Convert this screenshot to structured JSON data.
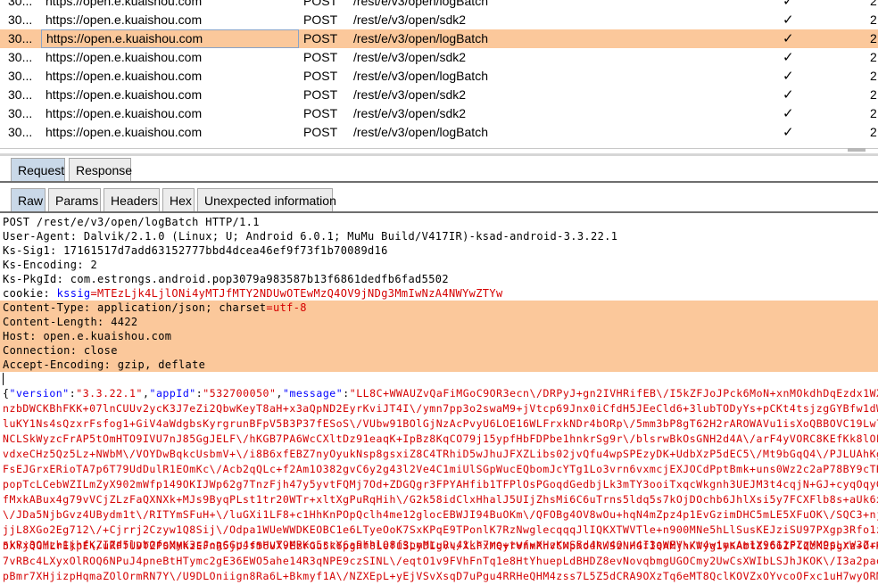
{
  "history": {
    "rows": [
      {
        "num": "30...",
        "host": "https://open.e.kuaishou.com",
        "method": "POST",
        "url": "/rest/e/v3/open/logBatch",
        "check": "✓",
        "last": "2",
        "selected": false
      },
      {
        "num": "30...",
        "host": "https://open.e.kuaishou.com",
        "method": "POST",
        "url": "/rest/e/v3/open/sdk2",
        "check": "✓",
        "last": "2",
        "selected": false
      },
      {
        "num": "30...",
        "host": "https://open.e.kuaishou.com",
        "method": "POST",
        "url": "/rest/e/v3/open/logBatch",
        "check": "✓",
        "last": "2",
        "selected": true
      },
      {
        "num": "30...",
        "host": "https://open.e.kuaishou.com",
        "method": "POST",
        "url": "/rest/e/v3/open/sdk2",
        "check": "✓",
        "last": "2",
        "selected": false
      },
      {
        "num": "30...",
        "host": "https://open.e.kuaishou.com",
        "method": "POST",
        "url": "/rest/e/v3/open/logBatch",
        "check": "✓",
        "last": "2",
        "selected": false
      },
      {
        "num": "30...",
        "host": "https://open.e.kuaishou.com",
        "method": "POST",
        "url": "/rest/e/v3/open/sdk2",
        "check": "✓",
        "last": "2",
        "selected": false
      },
      {
        "num": "30...",
        "host": "https://open.e.kuaishou.com",
        "method": "POST",
        "url": "/rest/e/v3/open/sdk2",
        "check": "✓",
        "last": "2",
        "selected": false
      },
      {
        "num": "30...",
        "host": "https://open.e.kuaishou.com",
        "method": "POST",
        "url": "/rest/e/v3/open/logBatch",
        "check": "✓",
        "last": "2",
        "selected": false
      }
    ]
  },
  "main_tabs": {
    "request": "Request",
    "response": "Response"
  },
  "sub_tabs": {
    "raw": "Raw",
    "params": "Params",
    "headers": "Headers",
    "hex": "Hex",
    "unexpected": "Unexpected information"
  },
  "request": {
    "line1": "POST /rest/e/v3/open/logBatch HTTP/1.1",
    "line2": "User-Agent: Dalvik/2.1.0 (Linux; U; Android 6.0.1; MuMu Build/V417IR)-ksad-android-3.3.22.1",
    "line3": "Ks-Sig1: 17161517d7add63152777bbd4dcea46ef9f73f1b70089d16",
    "line4": "Ks-Encoding: 2",
    "line5": "Ks-PkgId: com.estrongs.android.pop3079a983587b13f6861dedfb6fad5502",
    "cookie_name": "cookie: ",
    "cookie_key": "kssig",
    "cookie_value": "=MTEzLjk4LjlONi4yMTJfMTY2NDUwOTEwMzQ4OV9jNDg3MmIwNzA4NWYwZTYw",
    "content_type_a": "Content-Type: application/json; charset",
    "content_type_b": "=utf-8",
    "line8": "Content-Length: 4422",
    "line9": "Host: open.e.kuaishou.com",
    "line10": "Connection: close",
    "line11": "Accept-Encoding: gzip, deflate"
  },
  "body": {
    "k_version": "\"version\"",
    "v_version": "\"3.3.22.1\"",
    "k_appid": "\"appId\"",
    "v_appid": "\"532700050\"",
    "k_message": "\"message\"",
    "v_message_start": "\"LL8C+WWAUZvQaFiMGoC9OR3ecn\\/DRPyJ+gn2IVHRifEB\\/I5kZFJoJPck6MoN+xnMOkdhDqEzdx1WXyJD8L6dY",
    "lines": [
      "nzbDWCKBhFKK+07lnCUUv2ycK3J7eZi2QbwKeyT8aH+x3aQpND2EyrKviJT4I\\/ymn7pp3o2swaM9+jVtcp69Jnx0iCfdH5JEeCld6+3lubTODyYs+pCKt4tsjzgGYBfw1dWdKko1NxB",
      "luKY1Ns4sQzxrFsfog1+GiV4aWdgbsKyrgrunBFpV5B3P37fESoS\\/VUbw91BOlGjNzAcPvyU6LOE16WLFrxkNDr4bORp\\/5mm3bP8gT62H2rAROWAVu1isXoQBBOVC19Lw72Lc\\/+3YK",
      "NCLSkWyzcFrAP5tOmHTO9IVU7nJ85GgJELF\\/hKGB7PA6WcCXltDz91eaqK+IpBz8KqCO79j15ypfHbFDPbe1hnkrSg9r\\/blsrwBkOsGNH2d4A\\/arF4yVORC8KEfKk8lOP5FnN4Mv3",
      "vdxeCHz5Qz5Lz+NWbM\\/VOYDwBqkcUsbmV+\\/i8B6xfEBZ7nyOyukNsp8gsxiZ8C4TRhiD5wJhuJFXZLibs02jvQfu4wpSPEzyDK+UdbXzP5dEC5\\/Mt9bGqQ4\\/PJLUAhKgCTfO2q4V",
      "FsEJGrxERioTA7p6T79UdDulR1EOmKc\\/Acb2qQLc+f2Am1O382gvC6y2g43l2Ve4C1miUlSGpWucEQbomJcYTg1Lo3vrn6vxmcjEXJOCdPptBmk+uns0Wz2c2aP78BY9cTKnijYPOhp",
      "popTcLCebWZILmZyX902mWfp149OKIJWp62g7TnzFjh47y5yvtFQMj7Od+ZDGQgr3FPYAHfib1TFPlOsPGoqdGedbjLk3mTY3ooiTxqcWkgnh3UEJM3t4cqjN+GJ+cyqOqyGmzvEb8N1",
      "fMxkABux4g79vVCjZLzFaQXNXk+MJs9ByqPLst1tr20WTr+xltXgPuRqHih\\/G2k58idClxHhalJ5UIjZhsMi6C6uTrns5ldq5s7kOjDOchb6JhlXsi5y7FCXFlb8s+aUk6xvWLQlcjp",
      "\\/JDa5NjbGvz4UBydm1t\\/RITYmSFuH+\\/luGXi1LF8+c1HhKnPOpQclh4me12glocEBWJI94BuOKm\\/QFOBg4OV8wOu+hqN4mZpz4p1EvGzimDHC5mLE5XFuOK\\/SQC3+njcEmLvsZk",
      "jjL8XGo2Eg712\\/+Cjrrj2Czyw1Q8Sij\\/Odpa1WUeWWDKEOBC1e6LTyeOoK7SxKPqE9TPonlK7RzNwglecqqqJlIQKXTWVTle+n900MNe5hLlSusKEJziSU97PXgp3Rfo1zsyRc1Qgj",
      "nkRx3QMzh1jhfKZIZd5lvbOfoMyK3sJogGGp4smHvT9MRKo5ccY6a5hhlO8f3pmMLuRu41kh7re+twfvXHzKwS5d4\\/4O\\/4I3aWEV\\/t4wimsAm1X9611FZqMM9pLrW3ZrABS\\/FL\\/",
      "5XYjQGmLrEkpE\\/uRFfUDTZPSXMkzEFnR5jUJf56UXvEzrGu5k6pgHf8LefuSLyDIgv\\/XLFxMQyrVnmRnvCMpKodRWSzNHGfIQAMjhKWyg1yKAbtZi66ZPlZzKESgXz+O+MeUXhZuel",
      "7vRBc4LXyxOlROQ6NPuJ4pneBtHTymc2gE36EWO5ahe14R3qNPE9czSINL\\/eqtO1v9FVhFnTq1e8HtYhuepLdBHDZ8evNovqbmgUGOCmy2UwCsXWIbLSJhJKOK\\/I3a2paoA4BXSShC",
      "pBmr7XHjizpHqmaZOlOrmRN7Y\\/U9DLOniign8Ra6L+Bkmyf1A\\/NZXEpL+yEjVSvXsqD7uPgu4RRHeQHM4zss7L5Z5dCRA9OXzTq6eMT8QclKOVZxOYvcoOFxc1uH7wyORMZKFL+97F"
    ]
  }
}
